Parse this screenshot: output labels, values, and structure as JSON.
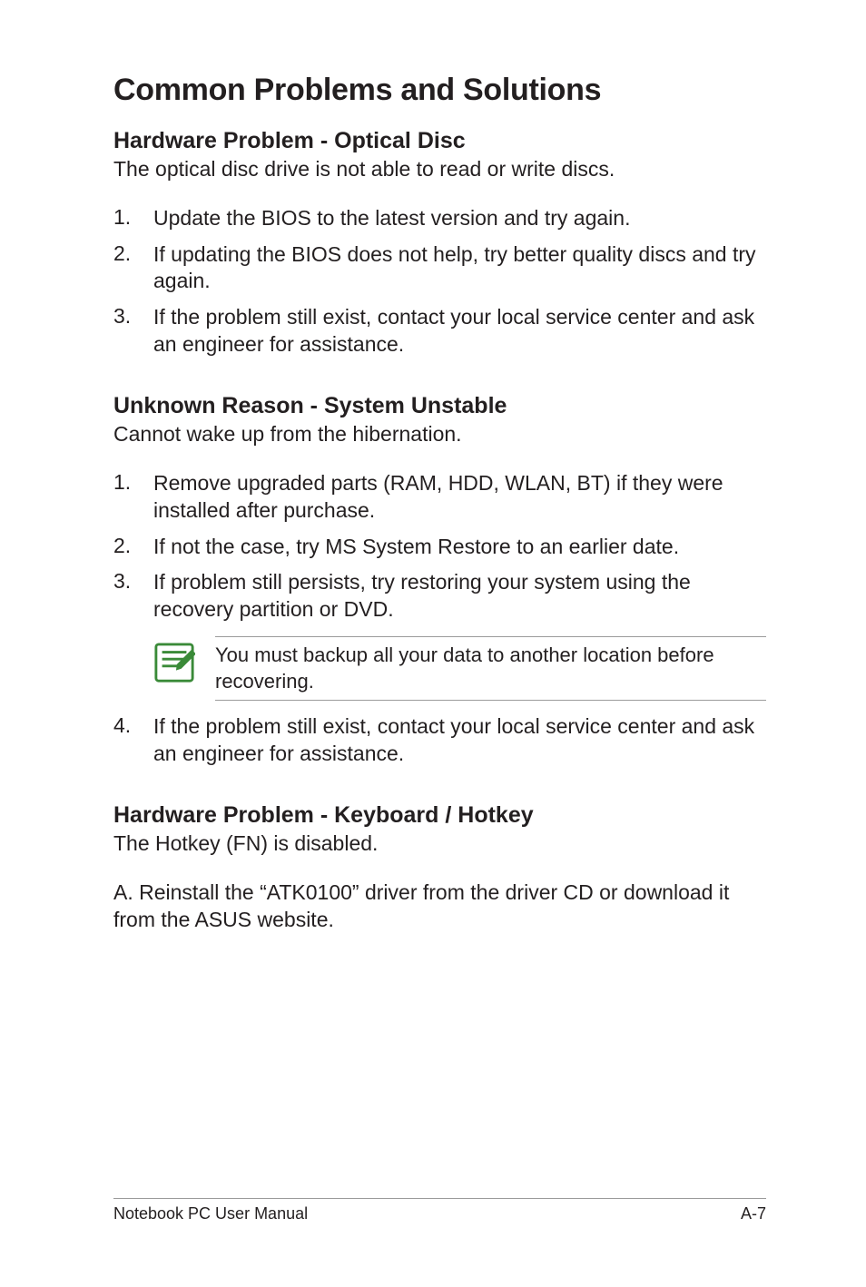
{
  "title": "Common Problems and Solutions",
  "sections": [
    {
      "heading": "Hardware Problem - Optical Disc",
      "intro": "The optical disc drive is not able to read or write discs.",
      "items": [
        "Update the BIOS to the latest version and try again.",
        "If updating the BIOS does not help, try better quality discs and try again.",
        "If the problem still exist, contact your local service center and ask an engineer for assistance."
      ]
    },
    {
      "heading": "Unknown Reason - System Unstable",
      "intro": "Cannot wake up from the hibernation.",
      "items": [
        "Remove upgraded parts (RAM, HDD, WLAN, BT) if they were installed after purchase.",
        "If not the case, try MS System Restore to an earlier date.",
        "If problem still persists, try restoring your system using the recovery partition or DVD."
      ],
      "note": "You must backup all your data to another location before recovering.",
      "after_note": {
        "num": "4.",
        "text": "If the problem still exist, contact your local service center and ask an engineer for assistance."
      }
    },
    {
      "heading": "Hardware Problem - Keyboard / Hotkey",
      "intro": "The Hotkey (FN) is disabled.",
      "para": "A. Reinstall the “ATK0100” driver from the driver CD or download it from the ASUS website."
    }
  ],
  "footer": {
    "left": "Notebook PC User Manual",
    "right": "A-7"
  },
  "list_numbers": [
    "1.",
    "2.",
    "3."
  ]
}
